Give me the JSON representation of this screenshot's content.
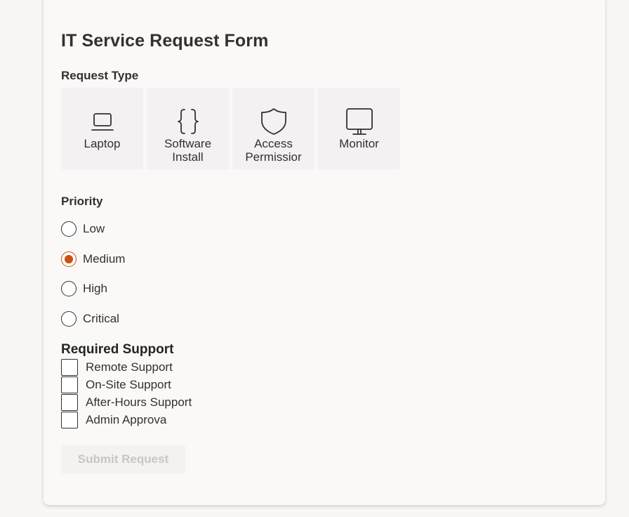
{
  "form": {
    "title": "IT Service Request Form",
    "request_type": {
      "label": "Request Type",
      "tiles": [
        {
          "label": "Laptop",
          "icon": "laptop-icon"
        },
        {
          "label": "Software Install",
          "icon": "code-braces-icon"
        },
        {
          "label": "Access Permissior",
          "icon": "shield-icon"
        },
        {
          "label": "Monitor",
          "icon": "monitor-icon"
        }
      ]
    },
    "priority": {
      "label": "Priority",
      "options": [
        "Low",
        "Medium",
        "High",
        "Critical"
      ],
      "selected": "Medium"
    },
    "support": {
      "label": "Required Support",
      "options": [
        "Remote Support",
        "On-Site Support",
        "After-Hours Support",
        "Admin Approva"
      ]
    },
    "submit_label": "Submit Request"
  },
  "colors": {
    "accent": "#ca5010",
    "tile_bg": "#f3f1f1",
    "disabled_text": "#c8c6c4"
  }
}
